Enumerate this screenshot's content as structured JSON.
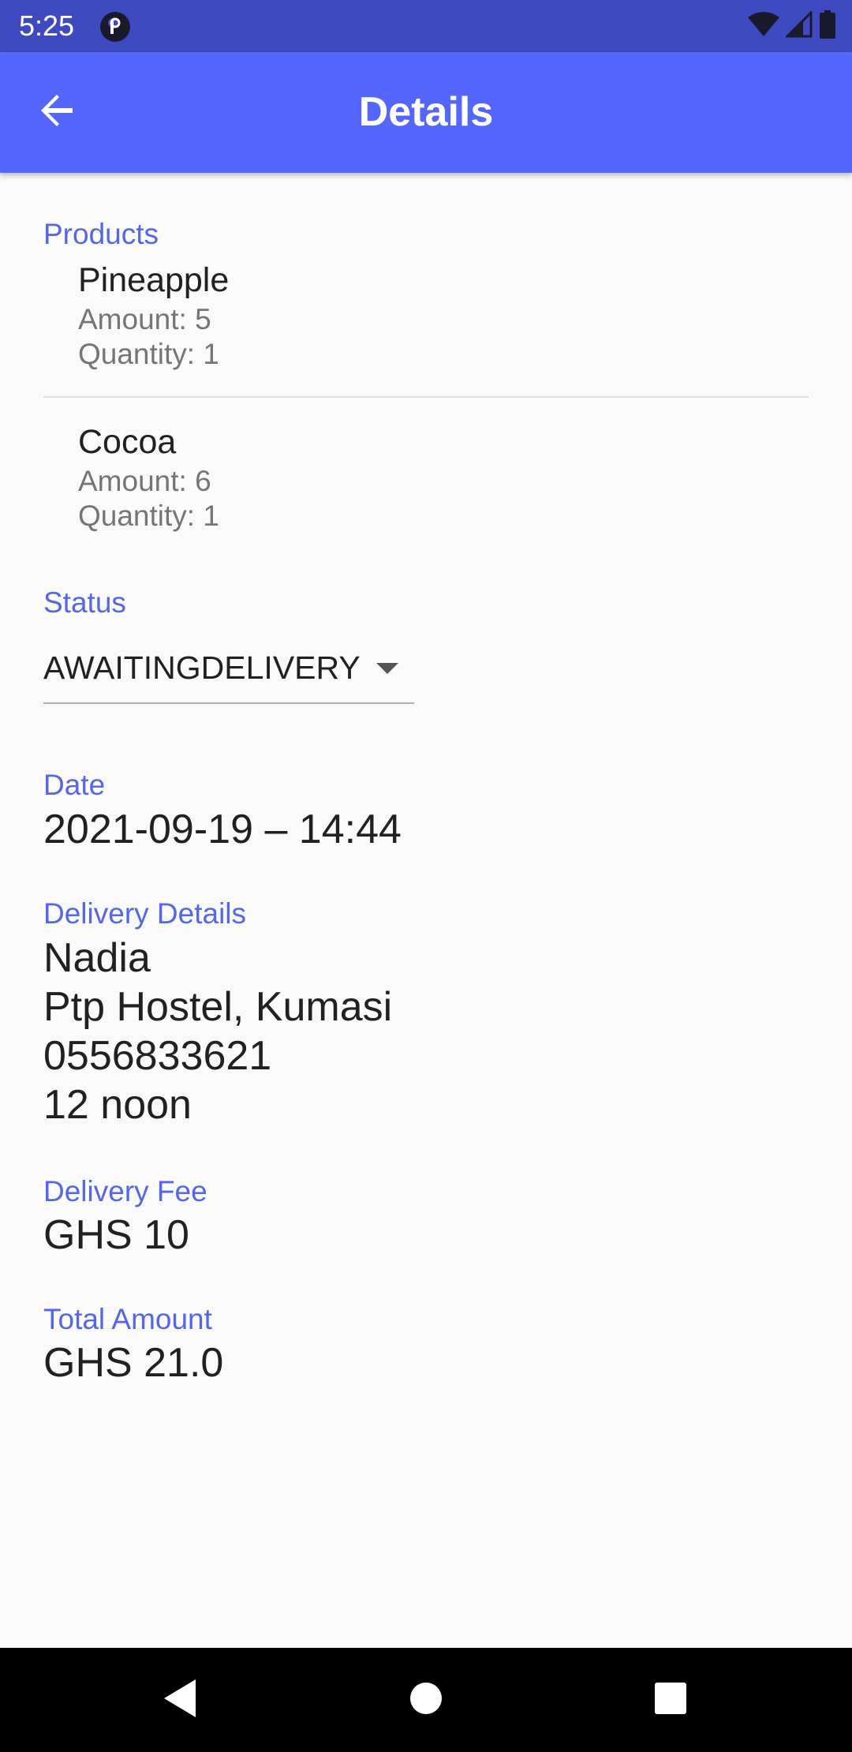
{
  "status_bar": {
    "time": "5:25"
  },
  "app_bar": {
    "title": "Details",
    "back_icon": "arrow-left-icon"
  },
  "products": {
    "label": "Products",
    "items": [
      {
        "name": "Pineapple",
        "amount": "Amount: 5",
        "quantity": "Quantity: 1"
      },
      {
        "name": "Cocoa",
        "amount": "Amount: 6",
        "quantity": "Quantity: 1"
      }
    ]
  },
  "status": {
    "label": "Status",
    "value": "AWAITINGDELIVERY"
  },
  "date": {
    "label": "Date",
    "value": "2021-09-19 – 14:44"
  },
  "delivery_details": {
    "label": "Delivery Details",
    "name": "Nadia",
    "location": "Ptp Hostel, Kumasi",
    "phone": "0556833621",
    "time": "12 noon"
  },
  "delivery_fee": {
    "label": "Delivery Fee",
    "value": "GHS 10"
  },
  "total_amount": {
    "label": "Total Amount",
    "value": "GHS 21.0"
  },
  "colors": {
    "app_bar": "#5566fd",
    "status_bar": "#3f4ac1",
    "accent_label": "#5566e6"
  }
}
